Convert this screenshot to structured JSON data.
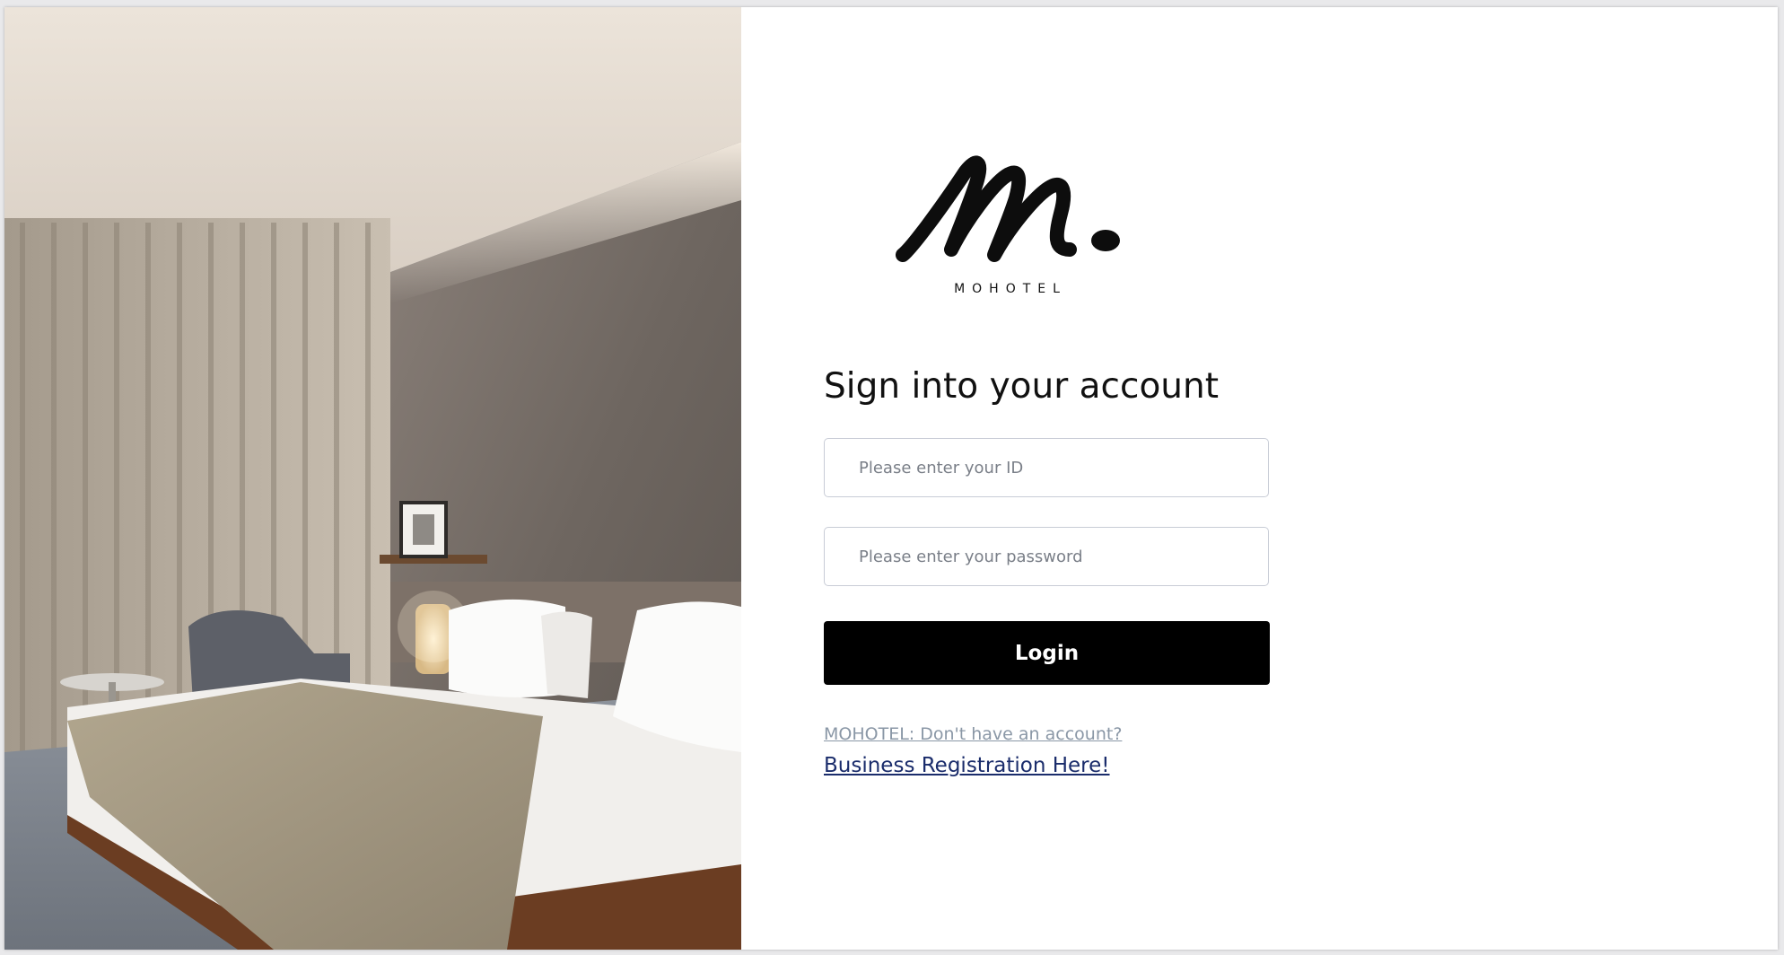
{
  "brand": {
    "logo_text": "M.",
    "name": "MOHOTEL"
  },
  "hero_image": {
    "alt": "Hotel room with bed, armchair and lamp"
  },
  "form": {
    "heading": "Sign into your account",
    "id_placeholder": "Please enter your ID",
    "password_placeholder": "Please enter your password",
    "login_label": "Login"
  },
  "footer": {
    "signup_prompt": "MOHOTEL: Don't have an account?",
    "register_link": "Business Registration Here!"
  },
  "colors": {
    "button_bg": "#000000",
    "button_text": "#ffffff",
    "prompt_link": "#8a97a6",
    "register_link": "#1a2c6b"
  }
}
